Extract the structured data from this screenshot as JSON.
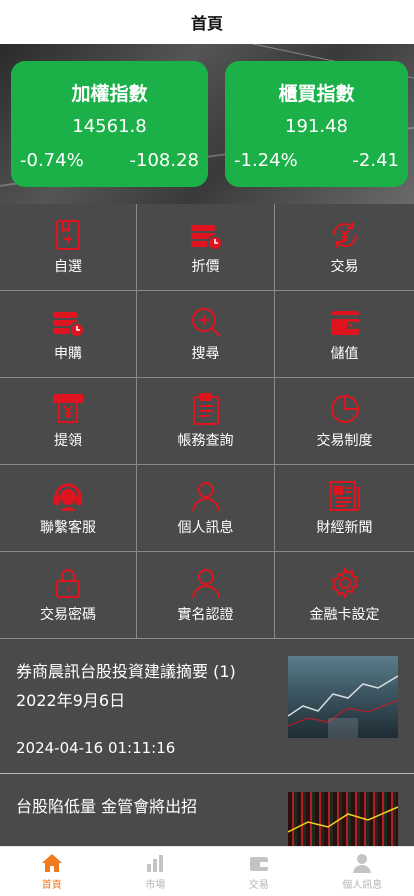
{
  "header": {
    "title": "首頁"
  },
  "indices": [
    {
      "name": "加權指數",
      "value": "14561.8",
      "percent": "-0.74%",
      "change": "-108.28"
    },
    {
      "name": "櫃買指數",
      "value": "191.48",
      "percent": "-1.24%",
      "change": "-2.41"
    }
  ],
  "menu": [
    {
      "label": "自選",
      "icon": "bookmark-plus-icon"
    },
    {
      "label": "折價",
      "icon": "coins-clock-icon"
    },
    {
      "label": "交易",
      "icon": "yen-cycle-icon"
    },
    {
      "label": "申購",
      "icon": "coins-clock-icon"
    },
    {
      "label": "搜尋",
      "icon": "search-plus-icon"
    },
    {
      "label": "儲值",
      "icon": "wallet-icon"
    },
    {
      "label": "提領",
      "icon": "atm-withdraw-icon"
    },
    {
      "label": "帳務查詢",
      "icon": "clipboard-list-icon"
    },
    {
      "label": "交易制度",
      "icon": "pie-chart-icon"
    },
    {
      "label": "聯繫客服",
      "icon": "headset-agent-icon"
    },
    {
      "label": "個人訊息",
      "icon": "user-icon"
    },
    {
      "label": "財經新聞",
      "icon": "newspaper-icon"
    },
    {
      "label": "交易密碼",
      "icon": "padlock-icon"
    },
    {
      "label": "實名認證",
      "icon": "user-icon"
    },
    {
      "label": "金融卡設定",
      "icon": "gear-icon"
    }
  ],
  "news": [
    {
      "title": "券商晨訊台股投資建議摘要 (1) 2022年9月6日",
      "date": "2024-04-16 01:11:16"
    },
    {
      "title": "台股陷低量 金管會將出招",
      "date": ""
    }
  ],
  "tabs": [
    {
      "label": "首頁",
      "icon": "home-icon",
      "active": true
    },
    {
      "label": "市場",
      "icon": "bar-chart-icon",
      "active": false
    },
    {
      "label": "交易",
      "icon": "wallet-icon",
      "active": false
    },
    {
      "label": "個人訊息",
      "icon": "user-icon",
      "active": false
    }
  ],
  "colors": {
    "accent_red": "#e0141e",
    "index_green": "#1bb148",
    "tab_active": "#f07a1e",
    "tab_inactive": "#c4c4c4"
  }
}
